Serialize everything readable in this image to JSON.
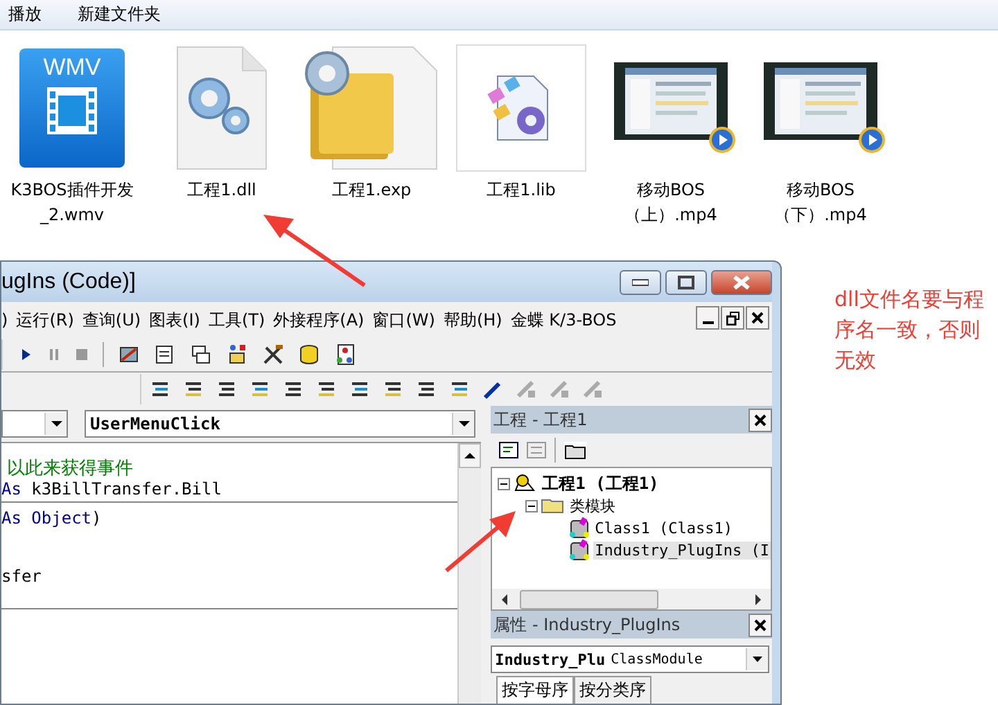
{
  "explorer_toolbar": [
    {
      "label": "播放"
    },
    {
      "label": "新建文件夹"
    }
  ],
  "files": [
    {
      "kind": "wmv",
      "badge": "WMV",
      "name": "K3BOS插件开发_2.wmv"
    },
    {
      "kind": "dll",
      "name": "工程1.dll"
    },
    {
      "kind": "exp",
      "name": "工程1.exp"
    },
    {
      "kind": "lib",
      "name": "工程1.lib"
    },
    {
      "kind": "video",
      "name": "移动BOS（上）.mp4"
    },
    {
      "kind": "video",
      "name": "移动BOS（下）.mp4"
    }
  ],
  "ide": {
    "title": "ugIns (Code)]",
    "menu": [
      {
        "label": ")"
      },
      {
        "label": "运行(R)"
      },
      {
        "label": "查询(U)"
      },
      {
        "label": "图表(I)"
      },
      {
        "label": "工具(T)"
      },
      {
        "label": "外接程序(A)"
      },
      {
        "label": "窗口(W)"
      },
      {
        "label": "帮助(H)"
      },
      {
        "label": "金蝶 K/3-BOS"
      }
    ],
    "procedure_combo": {
      "value": "UserMenuClick"
    },
    "code_blocks": [
      [
        {
          "kind": "comment",
          "text": "以此来获得事件"
        },
        {
          "kind": "code",
          "segments": [
            {
              "kind": "keyword",
              "text": "As"
            },
            {
              "kind": "plain",
              "text": " k3BillTransfer.Bill"
            }
          ]
        }
      ],
      [
        {
          "kind": "code",
          "segments": [
            {
              "kind": "keyword",
              "text": "As Object"
            },
            {
              "kind": "plain",
              "text": ")"
            }
          ]
        },
        {
          "kind": "blank"
        },
        {
          "kind": "blank"
        },
        {
          "kind": "code",
          "segments": [
            {
              "kind": "plain",
              "text": "sfer"
            }
          ]
        },
        {
          "kind": "blank"
        }
      ],
      [
        {
          "kind": "blank"
        }
      ]
    ],
    "project": {
      "title": "工程 - 工程1",
      "tree": [
        {
          "label": "工程1 (工程1)",
          "kind": "project",
          "expanded": true,
          "selected": false,
          "children": [
            {
              "label": "类模块",
              "kind": "folder",
              "expanded": true,
              "selected": false,
              "children": [
                {
                  "label": "Class1 (Class1)",
                  "kind": "class",
                  "selected": false
                },
                {
                  "label": "Industry_PlugIns (I",
                  "kind": "class",
                  "selected": true
                }
              ]
            }
          ]
        }
      ]
    },
    "properties": {
      "title": "属性 - Industry_PlugIns",
      "object_name": "Industry_Plu",
      "object_type": "ClassModule",
      "tabs": [
        {
          "label": "按字母序",
          "selected": true
        },
        {
          "label": "按分类序",
          "selected": false
        }
      ]
    }
  },
  "annotation": {
    "text": "dll文件名要与程序名一致，否则无效"
  }
}
